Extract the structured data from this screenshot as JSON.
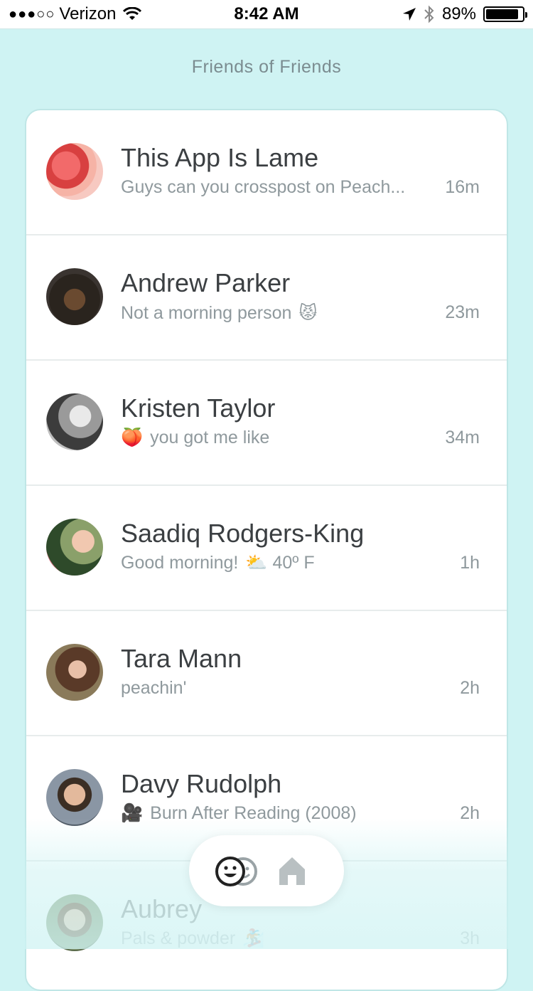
{
  "status_bar": {
    "signal_dots": "●●●○○",
    "carrier": "Verizon",
    "time": "8:42 AM",
    "battery": "89%",
    "battery_level": 0.89
  },
  "header": {
    "title": "Friends of Friends"
  },
  "feed": [
    {
      "name": "This App Is Lame",
      "status": "Guys can you crosspost on Peach...",
      "prefix_emoji": "",
      "suffix_emoji": "",
      "time": "16m"
    },
    {
      "name": "Andrew Parker",
      "status": "Not a morning person",
      "prefix_emoji": "",
      "suffix_emoji": "😾",
      "time": "23m"
    },
    {
      "name": "Kristen Taylor",
      "status": "you got me like",
      "prefix_emoji": "🍑",
      "suffix_emoji": "",
      "time": "34m"
    },
    {
      "name": "Saadiq Rodgers-King",
      "status": "Good morning!",
      "prefix_emoji": "",
      "suffix_emoji": "⛅ 40º F",
      "time": "1h"
    },
    {
      "name": "Tara Mann",
      "status": "peachin'",
      "prefix_emoji": "",
      "suffix_emoji": "",
      "time": "2h"
    },
    {
      "name": "Davy Rudolph",
      "status": "Burn After Reading (2008)",
      "prefix_emoji": "🎥",
      "suffix_emoji": "",
      "time": "2h"
    },
    {
      "name": "Aubrey",
      "status": "Pals & powder",
      "prefix_emoji": "",
      "suffix_emoji": "🏂",
      "time": "3h"
    }
  ],
  "tabbar": {
    "friends_icon": "friends-faces-icon",
    "home_icon": "home-icon"
  },
  "colors": {
    "background": "#cff3f3",
    "text_primary": "#3b3f42",
    "text_secondary": "#8f999d"
  }
}
